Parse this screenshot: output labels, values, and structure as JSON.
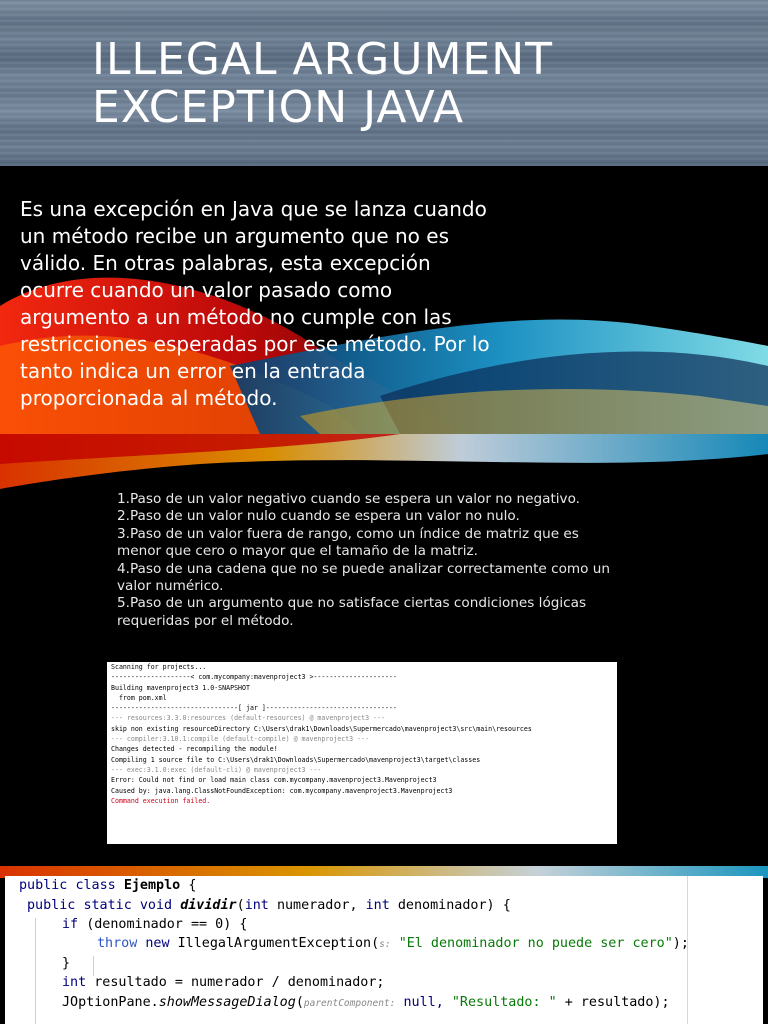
{
  "slide1": {
    "title_line1": "ILLEGAL ARGUMENT",
    "title_line2": "EXCEPTION JAVA"
  },
  "slide2": {
    "paragraph": "Es una excepción en Java que se lanza cuando un método recibe un argumento que no es válido. En otras palabras, esta excepción ocurre cuando un valor pasado como argumento a un método no cumple con las restricciones esperadas por ese método. Por lo tanto indica un error en la entrada proporcionada al método."
  },
  "slide3": {
    "items": [
      "1.Paso de un valor negativo cuando se espera un valor no negativo.",
      "2.Paso de un valor nulo cuando se espera un valor no nulo.",
      "3.Paso de un valor fuera de rango, como un índice de matriz que es menor que cero o mayor que el tamaño de la matriz.",
      "4.Paso de una cadena que no se puede analizar correctamente como un valor numérico.",
      "5.Paso de un argumento que no satisface ciertas condiciones lógicas requeridas por el método."
    ],
    "console": [
      "Scanning for projects...",
      "",
      "--------------------< com.mycompany:mavenproject3 >---------------------",
      "Building mavenproject3 1.0-SNAPSHOT",
      "  from pom.xml",
      "--------------------------------[ jar ]---------------------------------",
      "",
      "--- resources:3.3.0:resources (default-resources) @ mavenproject3 ---",
      "skip non existing resourceDirectory C:\\Users\\drak1\\Downloads\\Supermercado\\mavenproject3\\src\\main\\resources",
      "",
      "--- compiler:3.10.1:compile (default-compile) @ mavenproject3 ---",
      "Changes detected - recompiling the module!",
      "Compiling 1 source file to C:\\Users\\drak1\\Downloads\\Supermercado\\mavenproject3\\target\\classes",
      "",
      "--- exec:3.1.0:exec (default-cli) @ mavenproject3 ---",
      "Error: Could not find or load main class com.mycompany.mavenproject3.Mavenproject3",
      "Caused by: java.lang.ClassNotFoundException: com.mycompany.mavenproject3.Mavenproject3",
      "Command execution failed."
    ]
  },
  "slide4": {
    "kw_public": "public",
    "kw_class": "class",
    "class_name": "Ejemplo",
    "open_brace": "{",
    "kw_static": "static",
    "kw_void": "void",
    "method_name": "dividir",
    "kw_int": "int",
    "param1": "numerador,",
    "param2": "denominador)",
    "kw_if": "if",
    "if_cond": "(denominador == 0) {",
    "kw_throw": "throw",
    "kw_new": "new",
    "exception_class": "IllegalArgumentException(",
    "hint_s": "s:",
    "exception_msg": "\"El denominador no puede ser cero\"",
    "stmt_end": ");",
    "close_brace": "}",
    "result_decl": "resultado = numerador / denominador;",
    "joption": "JOptionPane.",
    "joption_method": "showMessageDialog",
    "joption_open": "(",
    "hint_parent": "parentComponent:",
    "kw_null": "null,",
    "result_str": "\"Resultado: \"",
    "result_tail": "+ resultado);"
  },
  "colors": {
    "keyword": "#000080",
    "string": "#077a07",
    "error": "#d0021b"
  }
}
